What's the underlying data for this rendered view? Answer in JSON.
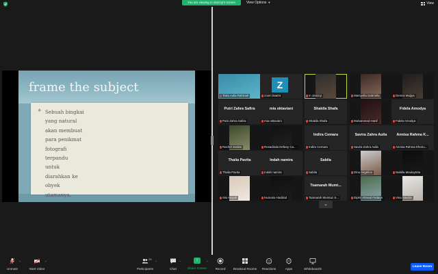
{
  "header": {
    "sharing_banner": "You are viewing m olarizqi's screen",
    "view_options_label": "View Options",
    "view_label": "View"
  },
  "slide": {
    "title": "frame the subject",
    "bullet_symbol": "❖",
    "lines": [
      "Sebuah bingkai",
      "yang natural",
      "akan membuat",
      "para penikmat",
      "fotografi",
      "terpandu",
      "untuk",
      "diarahkan ke",
      "obyek",
      "utamanya."
    ]
  },
  "participants": [
    {
      "label": "Tiara Aulia Rahmah",
      "big_name": "",
      "type": "video"
    },
    {
      "label": "zoom baa04",
      "big_name": "",
      "type": "z"
    },
    {
      "label": "m olarizqi",
      "big_name": "",
      "type": "video"
    },
    {
      "label": "Marsyella Gabriella",
      "big_name": "",
      "type": "video"
    },
    {
      "label": "Dennis Mujiya",
      "big_name": "",
      "type": "video"
    },
    {
      "label": "Putri Zahra Safira",
      "big_name": "Putri Zahra Safira",
      "type": "name"
    },
    {
      "label": "mia oktaviani",
      "big_name": "mia oktaviani",
      "type": "name"
    },
    {
      "label": "Shakila Shafa",
      "big_name": "Shakila Shafa",
      "type": "name"
    },
    {
      "label": "Muhammad Hanif",
      "big_name": "",
      "type": "video"
    },
    {
      "label": "Fidela Amodya",
      "big_name": "Fidela Amodya",
      "type": "name"
    },
    {
      "label": "Rachel Jordan",
      "big_name": "",
      "type": "video"
    },
    {
      "label": "Rosadinda Defany Ca...",
      "big_name": "",
      "type": "video"
    },
    {
      "label": "Indira Cemara",
      "big_name": "Indira Cemara",
      "type": "name"
    },
    {
      "label": "Savira Zahra Aulia",
      "big_name": "Savira Zahra Aulia",
      "type": "name"
    },
    {
      "label": "Annisa Rahma Khoiru...",
      "big_name": "Annisa Rahma K...",
      "type": "name"
    },
    {
      "label": "Thalia Pavita",
      "big_name": "Thalia Pavita",
      "type": "name"
    },
    {
      "label": "Indah namira",
      "big_name": "Indah namira",
      "type": "name"
    },
    {
      "label": "Sabila",
      "big_name": "Sabila",
      "type": "name"
    },
    {
      "label": "Dina Angelica",
      "big_name": "",
      "type": "video"
    },
    {
      "label": "Nabilla Maulaytrita",
      "big_name": "",
      "type": "video"
    },
    {
      "label": "Sisi Aisyah",
      "big_name": "",
      "type": "video"
    },
    {
      "label": "Humaira Haddad",
      "big_name": "",
      "type": "video"
    },
    {
      "label": "Tsamarah Mumtaz S...",
      "big_name": "Tsamarah Mumt...",
      "type": "name"
    },
    {
      "label": "Dipkri Ahmad Firdaus",
      "big_name": "",
      "type": "video"
    },
    {
      "label": "Vina Savitra",
      "big_name": "",
      "type": "video"
    }
  ],
  "gallery_next": "⌄",
  "toolbar": {
    "unmute": "Unmute",
    "start_video": "Start Video",
    "participants": "Participants",
    "participants_count": "29",
    "chat": "Chat",
    "share_screen": "Share Screen",
    "record": "Record",
    "breakout_rooms": "Breakout Rooms",
    "reactions": "Reactions",
    "apps": "Apps",
    "whiteboards": "Whiteboards",
    "leave": "Leave Room"
  },
  "colors": {
    "accent_green": "#23b26d",
    "leave_blue": "#0b5cff",
    "active_outline": "#c9d63f",
    "muted_red": "#e0413c"
  }
}
